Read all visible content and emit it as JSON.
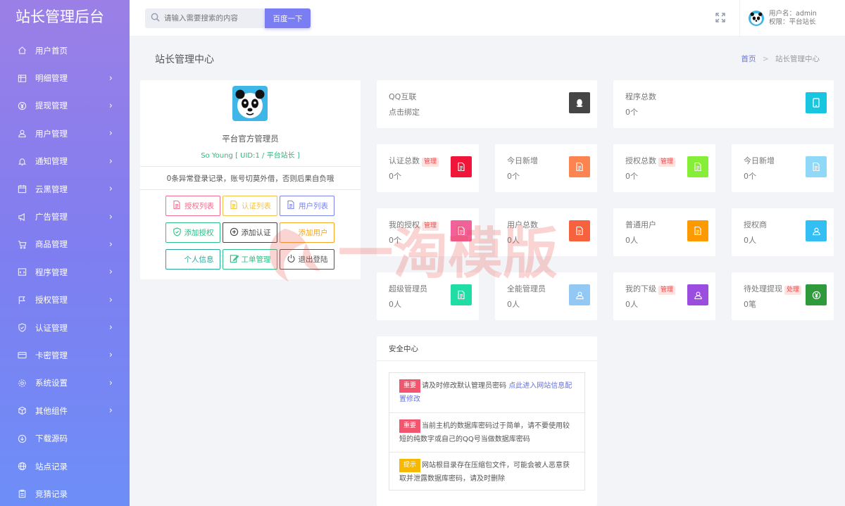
{
  "sidebar": {
    "logo": "站长管理后台",
    "items": [
      {
        "label": "用户首页",
        "icon": "home-icon",
        "arrow": false
      },
      {
        "label": "明细管理",
        "icon": "list-icon",
        "arrow": true
      },
      {
        "label": "提现管理",
        "icon": "yen-icon",
        "arrow": true
      },
      {
        "label": "用户管理",
        "icon": "user-icon",
        "arrow": true
      },
      {
        "label": "通知管理",
        "icon": "bell-icon",
        "arrow": true
      },
      {
        "label": "云黑管理",
        "icon": "calendar-icon",
        "arrow": true
      },
      {
        "label": "广告管理",
        "icon": "megaphone-icon",
        "arrow": true
      },
      {
        "label": "商品管理",
        "icon": "cart-icon",
        "arrow": true
      },
      {
        "label": "程序管理",
        "icon": "code-icon",
        "arrow": true
      },
      {
        "label": "授权管理",
        "icon": "flag-icon",
        "arrow": true
      },
      {
        "label": "认证管理",
        "icon": "shield-icon",
        "arrow": true
      },
      {
        "label": "卡密管理",
        "icon": "card-icon",
        "arrow": true
      },
      {
        "label": "系统设置",
        "icon": "gear-icon",
        "arrow": true
      },
      {
        "label": "其他组件",
        "icon": "box-icon",
        "arrow": true
      },
      {
        "label": "下载源码",
        "icon": "download-icon",
        "arrow": false
      },
      {
        "label": "站点记录",
        "icon": "globe-icon",
        "arrow": false
      },
      {
        "label": "竞猜记录",
        "icon": "clipboard-icon",
        "arrow": false
      }
    ]
  },
  "header": {
    "search_placeholder": "请输入需要搜索的内容",
    "search_button": "百度一下",
    "username": "用户名：admin",
    "role": "权限：平台站长"
  },
  "page": {
    "title": "站长管理中心",
    "breadcrumb_home": "首页",
    "breadcrumb_sep": ">",
    "breadcrumb_current": "站长管理中心"
  },
  "profile": {
    "name": "平台官方管理员",
    "uid": "So Young [ UID:1 / 平台站长 ]",
    "notice": "0条异常登录记录，账号切莫外借，否则后果自负哦",
    "buttons": [
      {
        "label": "授权列表",
        "color": "#f0708e",
        "icon": "document-icon"
      },
      {
        "label": "认证列表",
        "color": "#f3c24a",
        "icon": "document-icon"
      },
      {
        "label": "用户列表",
        "color": "#7b84ea",
        "icon": "document-icon"
      },
      {
        "label": "添加授权",
        "color": "#2fbf86",
        "icon": "shield-check-icon"
      },
      {
        "label": "添加认证",
        "color": "#444444",
        "icon": "plus-circle-icon"
      },
      {
        "label": "添加用户",
        "color": "#f6a623",
        "icon": "user-icon"
      },
      {
        "label": "个人信息",
        "color": "#2aa6a0",
        "icon": "user-icon"
      },
      {
        "label": "工单管理",
        "color": "#2fbf86",
        "icon": "edit-icon"
      },
      {
        "label": "退出登陆",
        "color": "#555555",
        "icon": "power-icon"
      }
    ]
  },
  "stats": [
    {
      "title": "QQ互联",
      "tag": "",
      "value": "点击绑定",
      "color": "#454545",
      "icon": "qq-icon"
    },
    {
      "title": "程序总数",
      "tag": "",
      "value": "0个",
      "color": "#19c6e0",
      "icon": "tablet-icon"
    },
    {
      "title": "认证总数",
      "tag": "管理",
      "value": "0个",
      "color": "#f0163a",
      "icon": "document-icon"
    },
    {
      "title": "今日新增",
      "tag": "",
      "value": "0个",
      "color": "#fb8450",
      "icon": "document-icon"
    },
    {
      "title": "授权总数",
      "tag": "管理",
      "value": "0个",
      "color": "#86ee36",
      "icon": "document-icon"
    },
    {
      "title": "今日新增",
      "tag": "",
      "value": "0个",
      "color": "#8fd8f8",
      "icon": "document-icon"
    },
    {
      "title": "我的授权",
      "tag": "管理",
      "value": "0个",
      "color": "#f2629a",
      "icon": "document-icon"
    },
    {
      "title": "用户总数",
      "tag": "",
      "value": "0人",
      "color": "#f7623e",
      "icon": "document-icon"
    },
    {
      "title": "普通用户",
      "tag": "",
      "value": "0人",
      "color": "#fd9a00",
      "icon": "document-icon"
    },
    {
      "title": "授权商",
      "tag": "",
      "value": "0人",
      "color": "#34bff4",
      "icon": "user-icon"
    },
    {
      "title": "超级管理员",
      "tag": "",
      "value": "0人",
      "color": "#20dda6",
      "icon": "document-icon"
    },
    {
      "title": "全能管理员",
      "tag": "",
      "value": "0人",
      "color": "#94c8f4",
      "icon": "user-icon"
    },
    {
      "title": "我的下级",
      "tag": "管理",
      "value": "0人",
      "color": "#9b4de0",
      "icon": "user-icon"
    },
    {
      "title": "待处理提现",
      "tag": "处理",
      "value": "0笔",
      "color": "#2e9a3c",
      "icon": "yen-icon"
    }
  ],
  "security": {
    "title": "安全中心",
    "rows": [
      {
        "badge": "重要",
        "badge_color": "#f2566e",
        "text": "请及时修改默认管理员密码 ",
        "link": "点此进入网站信息配置修改"
      },
      {
        "badge": "重要",
        "badge_color": "#f2566e",
        "text": "当前主机的数据库密码过于简单，请不要使用较短的纯数字或自己的QQ号当做数据库密码",
        "link": ""
      },
      {
        "badge": "提示",
        "badge_color": "#f6b800",
        "text": "网站根目录存在压缩包文件，可能会被人恶意获取并泄露数据库密码，请及时删除",
        "link": ""
      }
    ]
  },
  "watermark": "一淘模版"
}
